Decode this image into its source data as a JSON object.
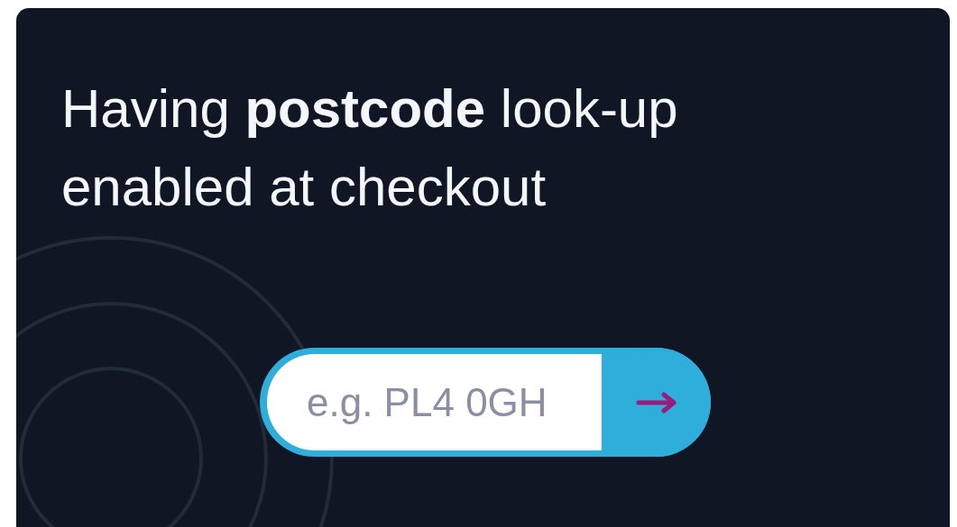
{
  "card": {
    "heading": "Having **postcode** look-up enabled at checkout"
  },
  "postcode_search": {
    "placeholder": "e.g. PL4 0GH"
  }
}
